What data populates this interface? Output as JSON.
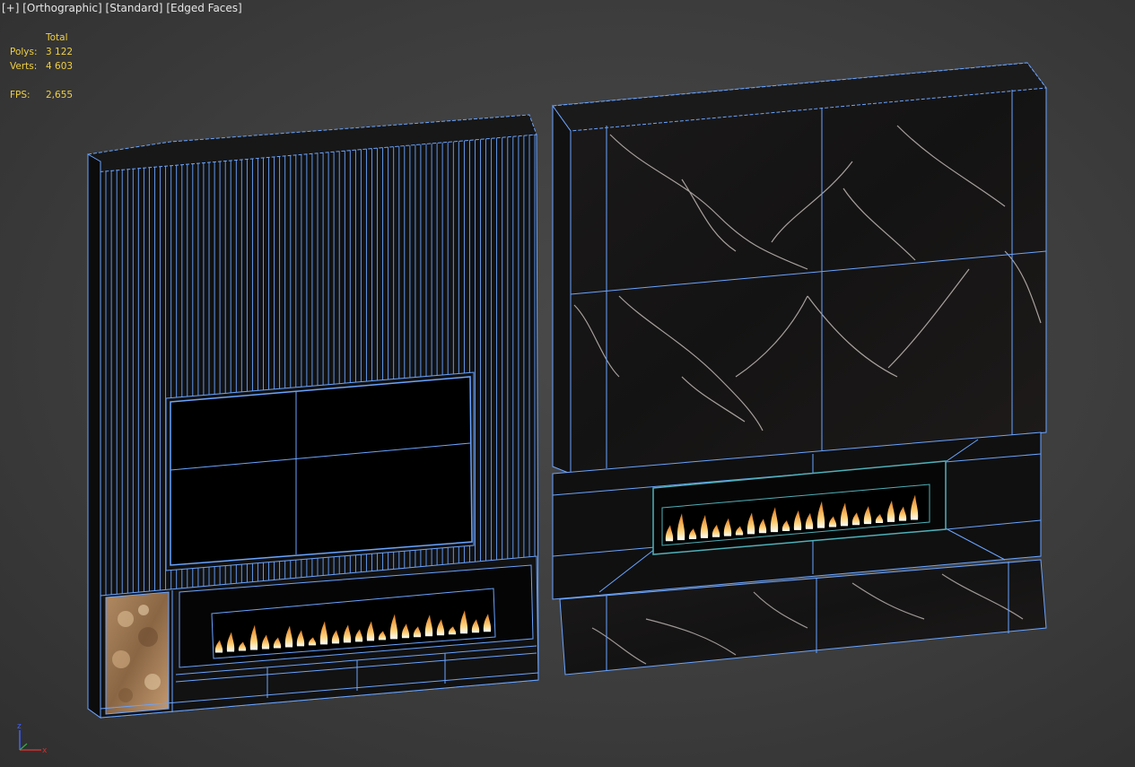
{
  "viewport": {
    "plus": "[+]",
    "view": "[Orthographic]",
    "shading": "[Standard]",
    "edges": "[Edged Faces]"
  },
  "stats": {
    "header": "Total",
    "polys_label": "Polys:",
    "polys_value": "3 122",
    "verts_label": "Verts:",
    "verts_value": "4 603",
    "fps_label": "FPS:",
    "fps_value": "2,655"
  },
  "axis_gizmo": {
    "x": "x",
    "z": "z"
  },
  "colors": {
    "wire": "#6aa4ff",
    "background": "#3d3d3d",
    "stats_text": "#f0d040",
    "axis_x": "#d03030",
    "axis_z": "#4060ff"
  },
  "icons": [
    "axis-gizmo-icon",
    "flame-icon"
  ]
}
